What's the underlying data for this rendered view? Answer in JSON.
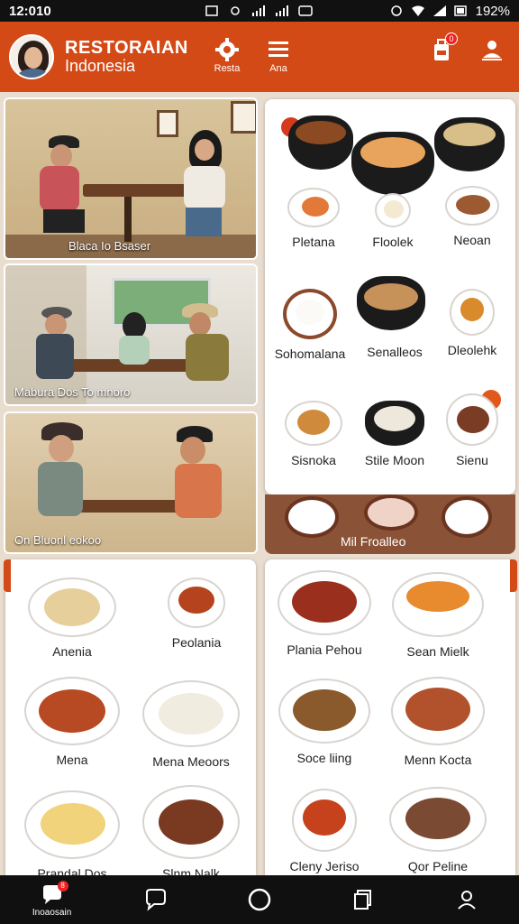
{
  "status_bar": {
    "time": "12:010",
    "battery": "192%"
  },
  "header": {
    "title": "RESTORAIAN",
    "subtitle": "Indonesia",
    "settings_label": "Resta",
    "menu_label": "Ana",
    "cart_badge": "0"
  },
  "photos": [
    {
      "caption": "Blaca Io Bsaser"
    },
    {
      "caption": "Mabura   Dos To mnoro"
    },
    {
      "caption": "On   Bluonl eokoo"
    }
  ],
  "menu_grid": {
    "items": [
      {
        "label": "Pletana"
      },
      {
        "label": "Floolek"
      },
      {
        "label": "Neoan"
      },
      {
        "label": "Sohomalana"
      },
      {
        "label": "Senalleos"
      },
      {
        "label": "Dleolehk"
      },
      {
        "label": "Sisnoka"
      },
      {
        "label": "Stile Moon"
      },
      {
        "label": "Sienu"
      }
    ]
  },
  "strip_caption": "Mil Froalleo",
  "left_grid": {
    "items": [
      {
        "label": "Anenia"
      },
      {
        "label": "Peolania"
      },
      {
        "label": "Mena"
      },
      {
        "label": "Mena Meoors"
      },
      {
        "label": "Prandal Dos"
      },
      {
        "label": "Slnm Nalk"
      }
    ]
  },
  "right_grid": {
    "items": [
      {
        "label": "Plania Pehou"
      },
      {
        "label": "Sean Mielk"
      },
      {
        "label": "Soce liing"
      },
      {
        "label": "Menn Kocta"
      },
      {
        "label": "Cleny Jeriso"
      },
      {
        "label": "Qor Peline"
      }
    ]
  },
  "bottom_nav": {
    "items": [
      {
        "label": "Inoaosain",
        "badge": "8"
      },
      {
        "label": ""
      },
      {
        "label": ""
      },
      {
        "label": ""
      },
      {
        "label": ""
      }
    ]
  },
  "colors": {
    "brand": "#d44a17",
    "accent_red": "#e22222"
  }
}
